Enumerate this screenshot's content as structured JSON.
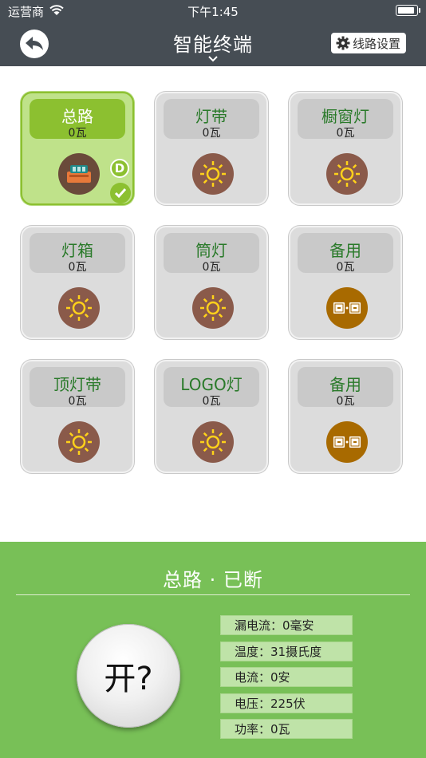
{
  "status_bar": {
    "carrier": "运营商",
    "time": "下午1:45"
  },
  "nav": {
    "title": "智能终端",
    "settings_label": "线路设置"
  },
  "tiles": [
    {
      "name": "总路",
      "power": "0瓦",
      "icon": "breaker-icon",
      "active": true
    },
    {
      "name": "灯带",
      "power": "0瓦",
      "icon": "sun-icon"
    },
    {
      "name": "橱窗灯",
      "power": "0瓦",
      "icon": "sun-icon"
    },
    {
      "name": "灯箱",
      "power": "0瓦",
      "icon": "sun-icon"
    },
    {
      "name": "筒灯",
      "power": "0瓦",
      "icon": "sun-icon"
    },
    {
      "name": "备用",
      "power": "0瓦",
      "icon": "on-off-switch-icon"
    },
    {
      "name": "顶灯带",
      "power": "0瓦",
      "icon": "sun-icon"
    },
    {
      "name": "LOGO灯",
      "power": "0瓦",
      "icon": "sun-icon"
    },
    {
      "name": "备用",
      "power": "0瓦",
      "icon": "on-off-switch-icon"
    }
  ],
  "badges": {
    "d": "D"
  },
  "panel": {
    "title": "总路 · 已断",
    "power_button": "开?",
    "readings": [
      "漏电流：0毫安",
      "温度：31摄氏度",
      "电流：0安",
      "电压：225伏",
      "功率：0瓦"
    ]
  },
  "colors": {
    "bar": "#464d54",
    "active_green": "#8cc030",
    "panel_green": "#78c057",
    "tile_grey": "#dcdcdc",
    "label_green": "#2a7a2a"
  }
}
